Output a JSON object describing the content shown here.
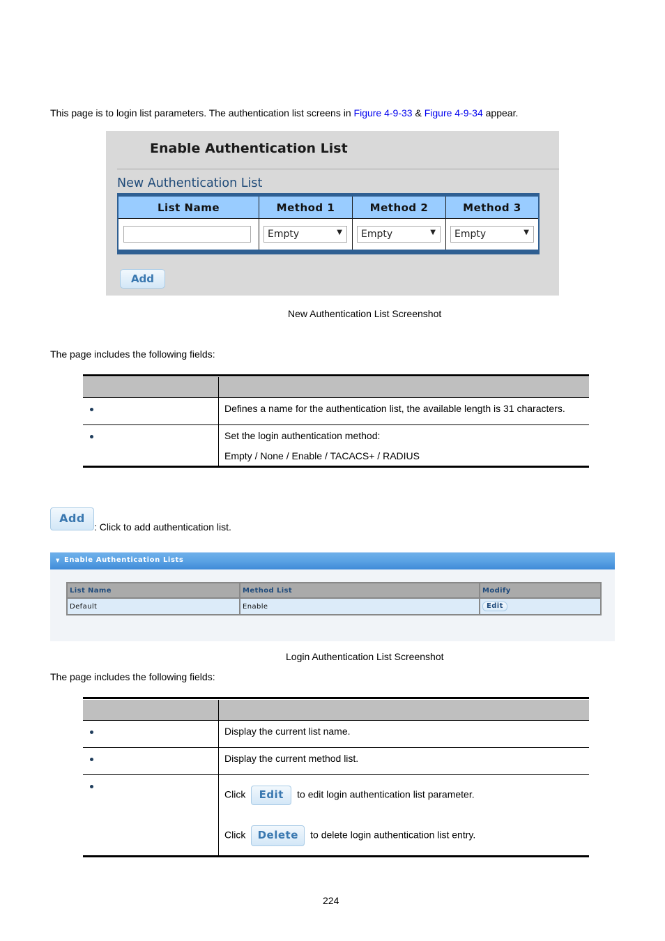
{
  "intro": {
    "text_before": "This page is to login list parameters. The authentication list screens in ",
    "link1": "Figure 4-9-33",
    "amp": " & ",
    "link2": "Figure 4-9-34",
    "text_after": " appear."
  },
  "figure1": {
    "title": "Enable Authentication List",
    "subtitle": "New Authentication List",
    "columns": [
      "List Name",
      "Method 1",
      "Method 2",
      "Method 3"
    ],
    "list_name_value": "",
    "method_values": [
      "Empty",
      "Empty",
      "Empty"
    ],
    "dropdown_icon": "triangle-down",
    "add_label": "Add",
    "caption": "New Authentication List Screenshot"
  },
  "fields_intro_1": "The page includes the following fields:",
  "table1": {
    "headers": [
      "",
      ""
    ],
    "rows": [
      {
        "label": "",
        "desc": [
          "Defines a name for the authentication list, the available length is 31 characters."
        ]
      },
      {
        "label": "",
        "desc": [
          "Set the login authentication method:",
          "Empty / None / Enable / TACACS+ / RADIUS"
        ]
      }
    ]
  },
  "add_note": {
    "button_label": "Add",
    "text": ": Click to add authentication list."
  },
  "figure2": {
    "panel_title": "Enable Authentication Lists",
    "collapse_icon": "triangle-down",
    "columns": [
      "List Name",
      "Method List",
      "Modify"
    ],
    "rows": [
      {
        "list_name": "Default",
        "method_list": "Enable",
        "modify": "Edit"
      }
    ],
    "caption": "Login Authentication List Screenshot"
  },
  "fields_intro_2": "The page includes the following fields:",
  "table2": {
    "headers": [
      "",
      ""
    ],
    "rows": [
      {
        "label": "",
        "desc": "Display the current list name."
      },
      {
        "label": "",
        "desc": "Display the current method list."
      },
      {
        "label": "",
        "click1": "Click",
        "btn1": "Edit",
        "text1": "to edit login authentication list parameter.",
        "click2": "Click",
        "btn2": "Delete",
        "text2": "to delete login authentication list entry."
      }
    ]
  },
  "page_number": "224"
}
